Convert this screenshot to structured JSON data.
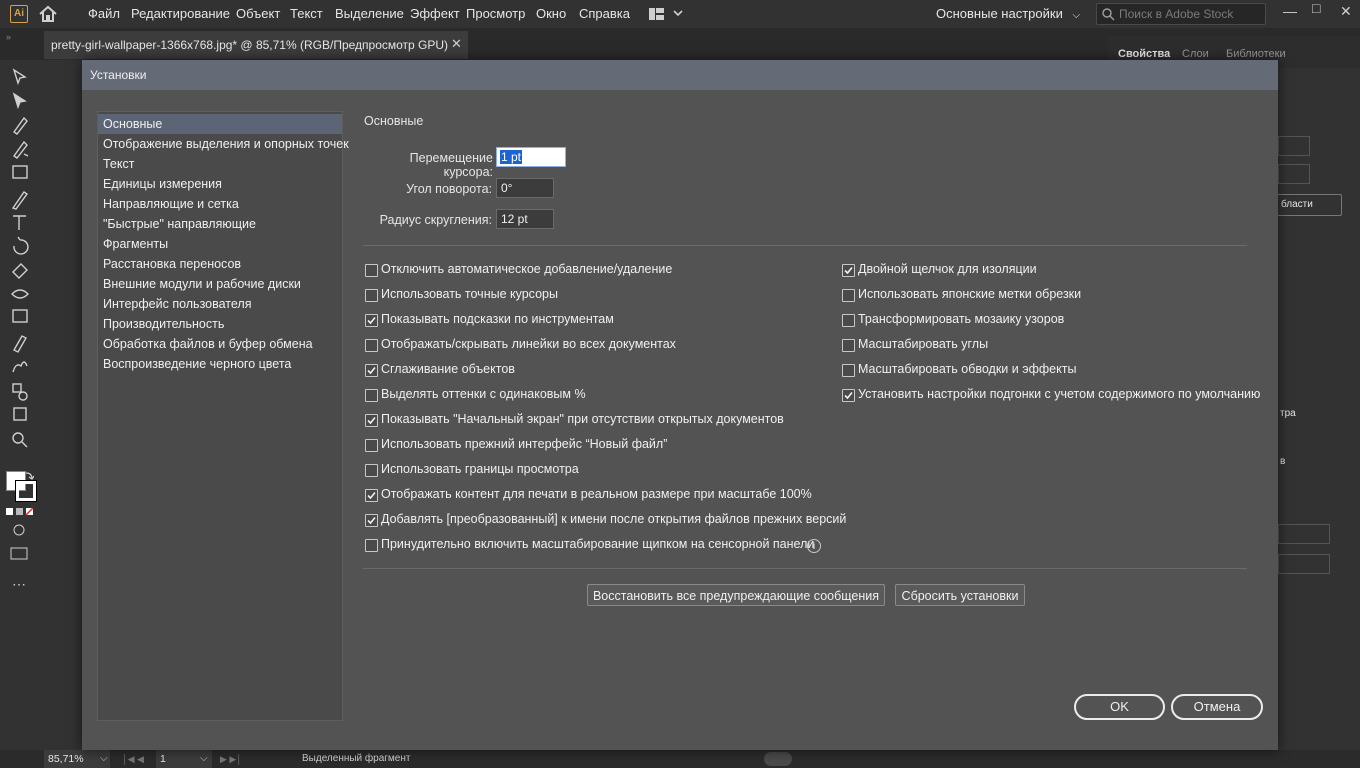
{
  "app": {
    "logo": "Ai",
    "menu": [
      "Файл",
      "Редактирование",
      "Объект",
      "Текст",
      "Выделение",
      "Эффект",
      "Просмотр",
      "Окно",
      "Справка"
    ],
    "workspace": "Основные настройки",
    "search_placeholder": "Поиск в Adobe Stock",
    "document_tab": "pretty-girl-wallpaper-1366x768.jpg* @ 85,71% (RGB/Предпросмотр GPU)",
    "right_panel_tabs": [
      "Свойства",
      "Слои",
      "Библиотеки"
    ],
    "right_panel_fragments": [
      "бласти",
      "тра",
      "в"
    ],
    "status": {
      "zoom": "85,71%",
      "artboard": "1",
      "selection_label": "Выделенный фрагмент"
    }
  },
  "dialog": {
    "title": "Установки",
    "categories": [
      "Основные",
      "Отображение выделения и опорных точек",
      "Текст",
      "Единицы измерения",
      "Направляющие и сетка",
      "\"Быстрые\" направляющие",
      "Фрагменты",
      "Расстановка переносов",
      "Внешние модули и рабочие диски",
      "Интерфейс пользователя",
      "Производительность",
      "Обработка файлов и буфер обмена",
      "Воспроизведение черного цвета"
    ],
    "selected_category": "Основные",
    "section_title": "Основные",
    "fields": [
      {
        "label": "Перемещение курсора:",
        "value": "1 pt"
      },
      {
        "label": "Угол поворота:",
        "value": "0°"
      },
      {
        "label": "Радиус скругления:",
        "value": "12 pt"
      }
    ],
    "left_checkboxes": [
      {
        "label": "Отключить автоматическое добавление/удаление",
        "checked": false
      },
      {
        "label": "Использовать точные курсоры",
        "checked": false
      },
      {
        "label": "Показывать подсказки по инструментам",
        "checked": true
      },
      {
        "label": "Отображать/скрывать линейки во всех документах",
        "checked": false
      },
      {
        "label": "Сглаживание объектов",
        "checked": true
      },
      {
        "label": "Выделять оттенки с одинаковым %",
        "checked": false
      },
      {
        "label": "Показывать \"Начальный экран\" при отсутствии открытых документов",
        "checked": true
      },
      {
        "label": "Использовать прежний интерфейс “Новый файл”",
        "checked": false
      },
      {
        "label": "Использовать границы просмотра",
        "checked": false
      },
      {
        "label": "Отображать контент для печати в реальном размере при масштабе 100%",
        "checked": true
      },
      {
        "label": "Добавлять [преобразованный] к имени после открытия файлов прежних версий",
        "checked": true
      },
      {
        "label": "Принудительно включить масштабирование щипком на сенсорной панели",
        "checked": false
      }
    ],
    "right_checkboxes": [
      {
        "label": "Двойной щелчок для изоляции",
        "checked": true
      },
      {
        "label": "Использовать японские метки обрезки",
        "checked": false
      },
      {
        "label": "Трансформировать мозаику узоров",
        "checked": false
      },
      {
        "label": "Масштабировать углы",
        "checked": false
      },
      {
        "label": "Масштабировать обводки и эффекты",
        "checked": false
      },
      {
        "label": "Установить настройки подгонки с учетом содержимого по умолчанию",
        "checked": true
      }
    ],
    "buttons": {
      "restore_warnings": "Восстановить все предупреждающие сообщения",
      "reset": "Сбросить установки",
      "ok": "OK",
      "cancel": "Отмена"
    },
    "colors": {
      "title_bar": "#646b76",
      "selected_row": "#5b6576",
      "body": "#535353"
    }
  }
}
